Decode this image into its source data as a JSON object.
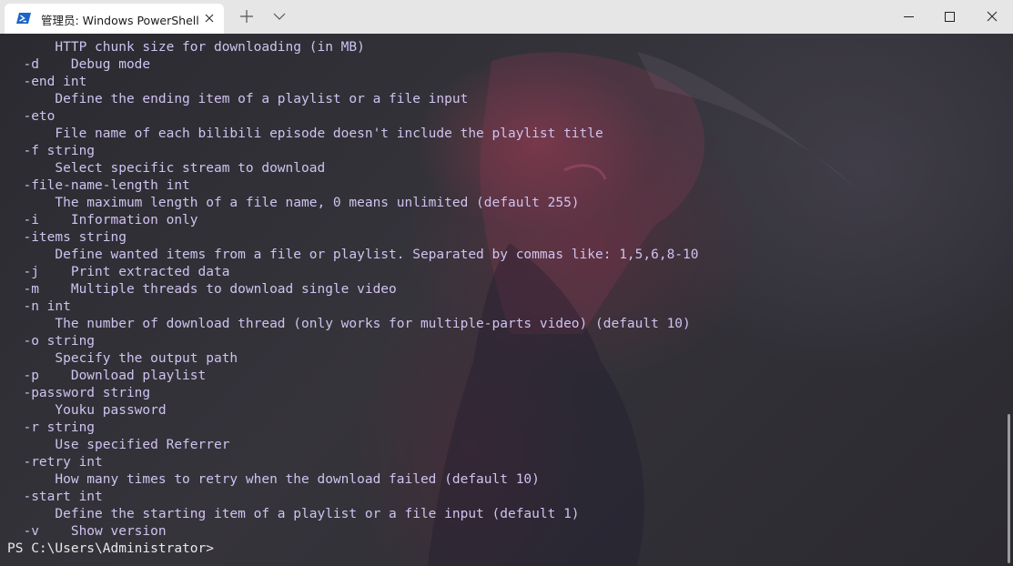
{
  "tab": {
    "title": "管理员: Windows PowerShell",
    "icon": "powershell-icon"
  },
  "titlebar": {
    "new_tab_icon": "plus-icon",
    "dropdown_icon": "chevron-down-icon"
  },
  "window_controls": {
    "minimize_icon": "minimize-icon",
    "maximize_icon": "maximize-icon",
    "close_icon": "close-icon"
  },
  "terminal": {
    "lines": [
      "      HTTP chunk size for downloading (in MB)",
      "  -d    Debug mode",
      "  -end int",
      "      Define the ending item of a playlist or a file input",
      "  -eto",
      "      File name of each bilibili episode doesn't include the playlist title",
      "  -f string",
      "      Select specific stream to download",
      "  -file-name-length int",
      "      The maximum length of a file name, 0 means unlimited (default 255)",
      "  -i    Information only",
      "  -items string",
      "      Define wanted items from a file or playlist. Separated by commas like: 1,5,6,8-10",
      "  -j    Print extracted data",
      "  -m    Multiple threads to download single video",
      "  -n int",
      "      The number of download thread (only works for multiple-parts video) (default 10)",
      "  -o string",
      "      Specify the output path",
      "  -p    Download playlist",
      "  -password string",
      "      Youku password",
      "  -r string",
      "      Use specified Referrer",
      "  -retry int",
      "      How many times to retry when the download failed (default 10)",
      "  -start int",
      "      Define the starting item of a playlist or a file input (default 1)",
      "  -v    Show version"
    ],
    "prompt": "PS C:\\Users\\Administrator>"
  }
}
